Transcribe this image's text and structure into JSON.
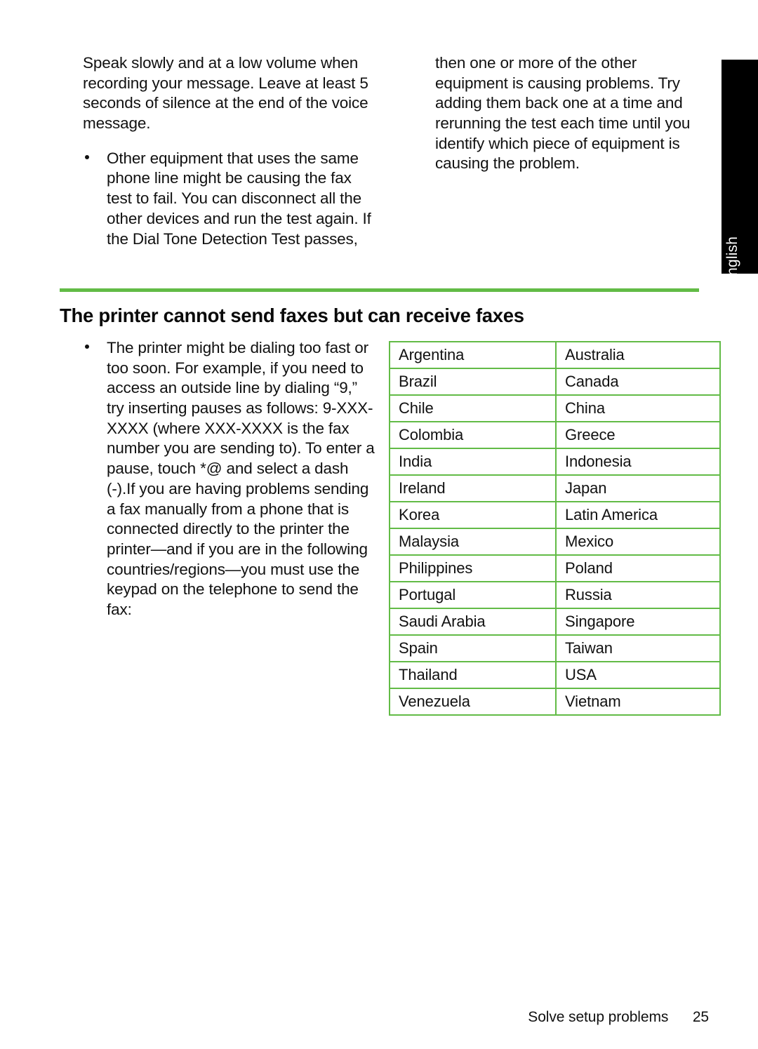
{
  "page": {
    "language_tab": "English",
    "page_number": "25",
    "chapter_footer": "Solve setup problems",
    "accent_color": "#62bb46",
    "tab_background_color": "#000000"
  },
  "top_section": {
    "left_column": {
      "continued_paragraph": "Speak slowly and at a low volume when recording your message. Leave at least 5 seconds of silence at the end of the voice message.",
      "bullets": [
        "Other equipment that uses the same phone line might be causing the fax test to fail. You can disconnect all the other devices and run the test again. If the Dial Tone Detection Test passes,"
      ]
    },
    "right_column": {
      "continued_paragraph": "then one or more of the other equipment is causing problems. Try adding them back one at a time and rerunning the test each time until you identify which piece of equipment is causing the problem."
    }
  },
  "section": {
    "heading": "The printer cannot send faxes but can receive faxes",
    "bullets": [
      "The printer might be dialing too fast or too soon. For example, if you need to access an outside line by dialing “9,” try inserting pauses as follows: 9-XXX-XXXX (where XXX-XXXX is the fax number you are sending to). To enter a pause, touch *@ and select a dash (-).If you are having problems sending a fax manually from a phone that is connected directly to the printer the printer—and if you are in the following countries/regions—you must use the keypad on the telephone to send the fax:"
    ]
  },
  "country_table": {
    "rows": [
      {
        "col1": "Argentina",
        "col2": "Australia"
      },
      {
        "col1": "Brazil",
        "col2": "Canada"
      },
      {
        "col1": "Chile",
        "col2": "China"
      },
      {
        "col1": "Colombia",
        "col2": "Greece"
      },
      {
        "col1": "India",
        "col2": "Indonesia"
      },
      {
        "col1": "Ireland",
        "col2": "Japan"
      },
      {
        "col1": "Korea",
        "col2": "Latin America"
      },
      {
        "col1": "Malaysia",
        "col2": "Mexico"
      },
      {
        "col1": "Philippines",
        "col2": "Poland"
      },
      {
        "col1": "Portugal",
        "col2": "Russia"
      },
      {
        "col1": "Saudi Arabia",
        "col2": "Singapore"
      },
      {
        "col1": "Spain",
        "col2": "Taiwan"
      },
      {
        "col1": "Thailand",
        "col2": "USA"
      },
      {
        "col1": "Venezuela",
        "col2": "Vietnam"
      }
    ]
  }
}
